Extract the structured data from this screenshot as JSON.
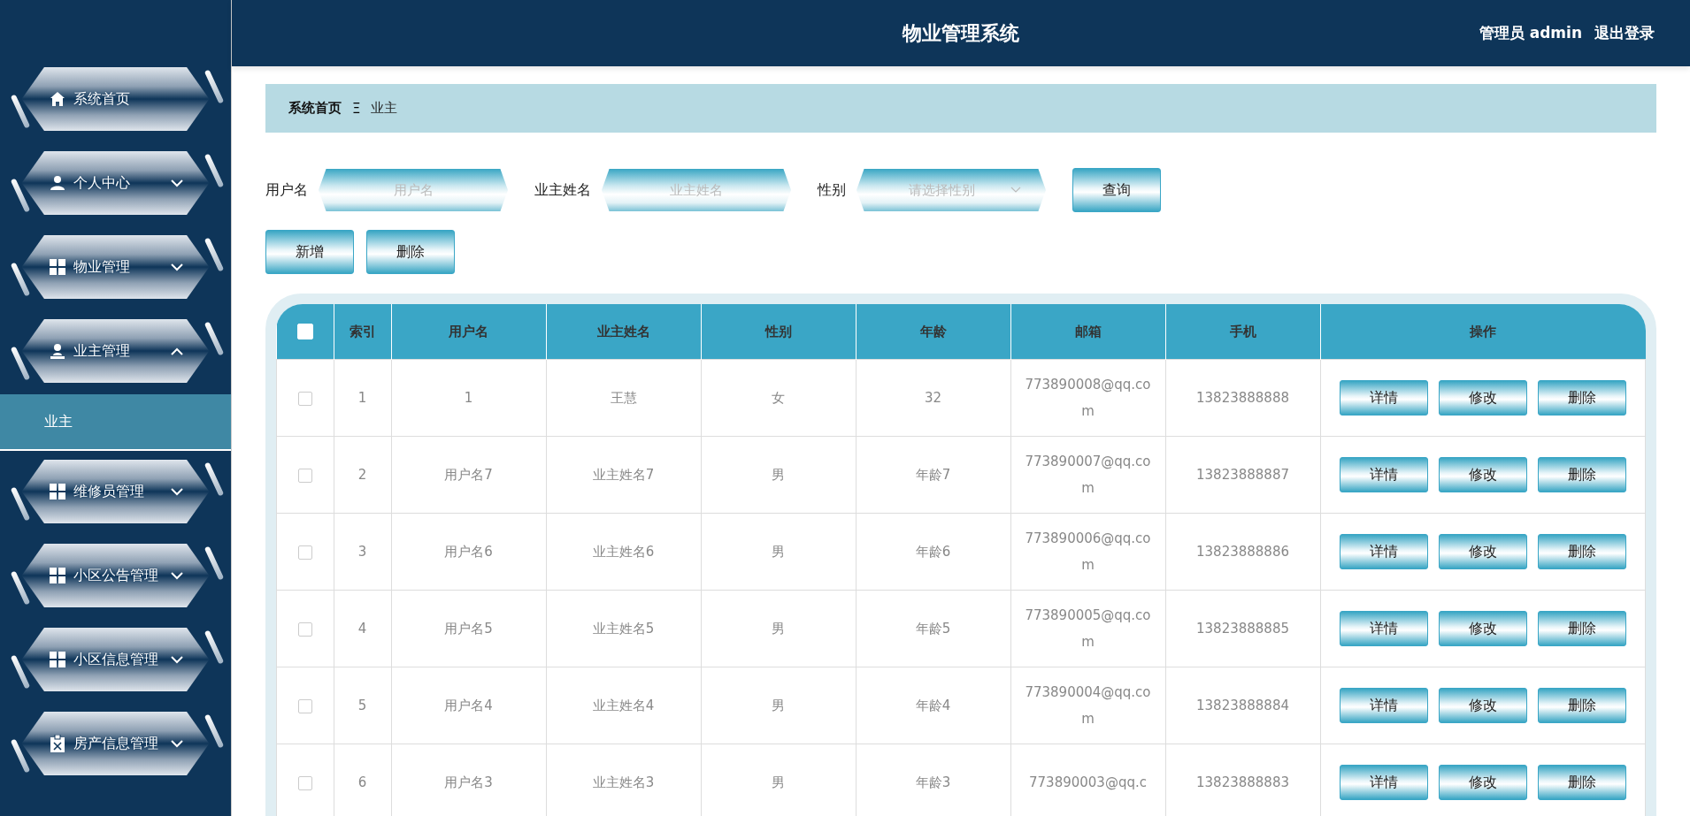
{
  "header": {
    "title": "物业管理系统",
    "user": "管理员 admin",
    "logout": "退出登录"
  },
  "sidebar": {
    "items": [
      {
        "label": "系统首页",
        "kind": "home"
      },
      {
        "label": "个人中心",
        "kind": "user",
        "expanded": false
      },
      {
        "label": "物业管理",
        "kind": "grid",
        "expanded": false
      },
      {
        "label": "业主管理",
        "kind": "stamp",
        "expanded": true,
        "children": [
          {
            "label": "业主",
            "selected": true
          }
        ]
      },
      {
        "label": "维修员管理",
        "kind": "grid",
        "expanded": false
      },
      {
        "label": "小区公告管理",
        "kind": "grid",
        "expanded": false
      },
      {
        "label": "小区信息管理",
        "kind": "grid",
        "expanded": false
      },
      {
        "label": "房产信息管理",
        "kind": "clipboard",
        "expanded": false
      }
    ]
  },
  "breadcrumb": {
    "home": "系统首页",
    "separator": "Ξ",
    "current": "业主"
  },
  "search": {
    "fields": [
      {
        "kind": "input",
        "label": "用户名",
        "placeholder": "用户名"
      },
      {
        "kind": "input",
        "label": "业主姓名",
        "placeholder": "业主姓名"
      },
      {
        "kind": "select",
        "label": "性别",
        "placeholder": "请选择性别"
      }
    ],
    "button": "查询"
  },
  "actions": [
    "新增",
    "删除"
  ],
  "table": {
    "select_all_checked": false,
    "columns": [
      "索引",
      "用户名",
      "业主姓名",
      "性别",
      "年龄",
      "邮箱",
      "手机",
      "操作"
    ],
    "rows": [
      {
        "checked": false,
        "cells": [
          "1",
          "1",
          "王慧",
          "女",
          "32",
          "773890008@qq.com",
          "13823888888"
        ],
        "buttons": [
          "详情",
          "修改",
          "删除"
        ]
      },
      {
        "checked": false,
        "cells": [
          "2",
          "用户名7",
          "业主姓名7",
          "男",
          "年龄7",
          "773890007@qq.com",
          "13823888887"
        ],
        "buttons": [
          "详情",
          "修改",
          "删除"
        ]
      },
      {
        "checked": false,
        "cells": [
          "3",
          "用户名6",
          "业主姓名6",
          "男",
          "年龄6",
          "773890006@qq.com",
          "13823888886"
        ],
        "buttons": [
          "详情",
          "修改",
          "删除"
        ]
      },
      {
        "checked": false,
        "cells": [
          "4",
          "用户名5",
          "业主姓名5",
          "男",
          "年龄5",
          "773890005@qq.com",
          "13823888885"
        ],
        "buttons": [
          "详情",
          "修改",
          "删除"
        ]
      },
      {
        "checked": false,
        "cells": [
          "5",
          "用户名4",
          "业主姓名4",
          "男",
          "年龄4",
          "773890004@qq.com",
          "13823888884"
        ],
        "buttons": [
          "详情",
          "修改",
          "删除"
        ]
      },
      {
        "checked": false,
        "cells": [
          "6",
          "用户名3",
          "业主姓名3",
          "男",
          "年龄3",
          "773890003@qq.c",
          "13823888883"
        ],
        "buttons": [
          "详情",
          "修改",
          "删除"
        ]
      }
    ]
  }
}
